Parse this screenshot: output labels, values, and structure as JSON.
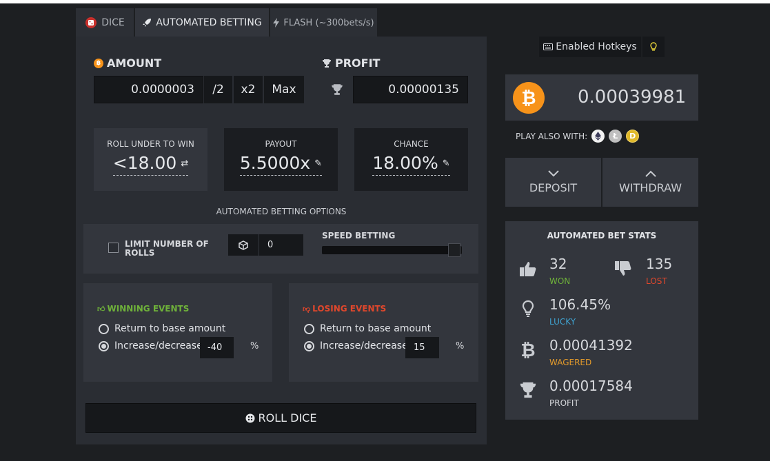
{
  "tabs": [
    {
      "label": "DICE",
      "icon": "dice-icon"
    },
    {
      "label": "AUTOMATED BETTING",
      "icon": "rocket-icon"
    },
    {
      "label": "FLASH (~300bets/s)",
      "icon": "bolt-icon"
    }
  ],
  "amount": {
    "label": "AMOUNT",
    "value": "0.0000003",
    "half": "/2",
    "double": "x2",
    "max": "Max"
  },
  "profit": {
    "label": "PROFIT",
    "value": "0.00000135"
  },
  "roll_under": {
    "label": "ROLL UNDER TO WIN",
    "value": "<18.00"
  },
  "payout": {
    "label": "PAYOUT",
    "value": "5.5000x"
  },
  "chance": {
    "label": "CHANCE",
    "value": "18.00%"
  },
  "options_title": "AUTOMATED BETTING OPTIONS",
  "limit_rolls": {
    "label_line1": "LIMIT NUMBER OF",
    "label_line2": "ROLLS",
    "value": "0",
    "checked": false
  },
  "speed": {
    "label": "SPEED BETTING",
    "level": 1.0
  },
  "winning": {
    "title": "WINNING EVENTS",
    "opt1": "Return to base amount",
    "opt2": "Increase/decrease",
    "value": "-40",
    "unit": "%",
    "selected": 2
  },
  "losing": {
    "title": "LOSING EVENTS",
    "opt1": "Return to base amount",
    "opt2": "Increase/decrease",
    "value": "15",
    "unit": "%",
    "selected": 2
  },
  "roll_button": "ROLL DICE",
  "hotkeys": "Enabled Hotkeys",
  "balance": "0.00039981",
  "play_also": "PLAY ALSO WITH:",
  "deposit": "DEPOSIT",
  "withdraw": "WITHDRAW",
  "stats": {
    "title": "AUTOMATED BET STATS",
    "won": {
      "value": "32",
      "label": "WON"
    },
    "lost": {
      "value": "135",
      "label": "LOST"
    },
    "lucky": {
      "value": "106.45%",
      "label": "LUCKY"
    },
    "wagered": {
      "value": "0.00041392",
      "label": "WAGERED"
    },
    "profit": {
      "value": "0.00017584",
      "label": "PROFIT"
    }
  },
  "colors": {
    "green": "#6fb23a",
    "red": "#e0472c",
    "blue": "#3fa3d1",
    "orange": "#e39a2b",
    "btc": "#f7931a"
  }
}
